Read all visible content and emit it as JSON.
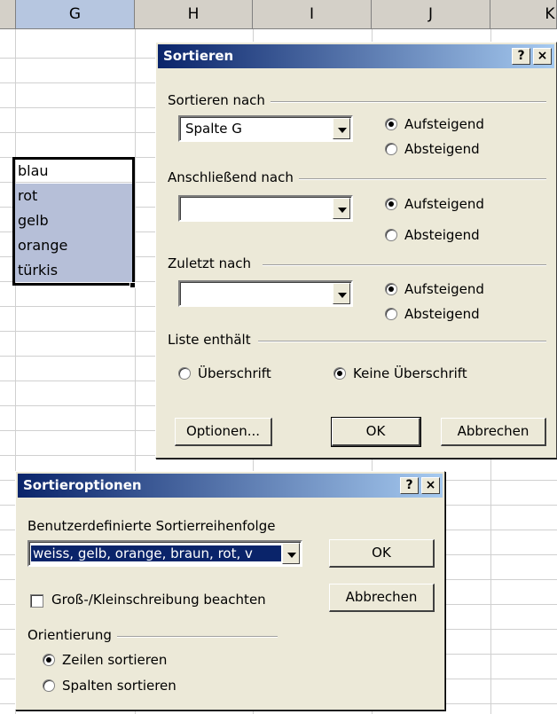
{
  "sheet": {
    "columns": [
      "G",
      "H",
      "I",
      "J",
      "K"
    ],
    "cells": [
      "blau",
      "rot",
      "gelb",
      "orange",
      "türkis"
    ]
  },
  "sort_dialog": {
    "title": "Sortieren",
    "help_label": "?",
    "close_label": "×",
    "sort_by": {
      "label": "Sortieren nach",
      "field_value": "Spalte G",
      "ascending": "Aufsteigend",
      "descending": "Absteigend",
      "selected": "ascending"
    },
    "then_by": {
      "label": "Anschließend nach",
      "field_value": "",
      "ascending": "Aufsteigend",
      "descending": "Absteigend",
      "selected": "ascending"
    },
    "last_by": {
      "label": "Zuletzt nach",
      "field_value": "",
      "ascending": "Aufsteigend",
      "descending": "Absteigend",
      "selected": "ascending"
    },
    "header_group": {
      "label": "Liste enthält",
      "with_header": "Überschrift",
      "no_header": "Keine Überschrift",
      "selected": "no_header"
    },
    "options_button": "Optionen...",
    "ok_button": "OK",
    "cancel_button": "Abbrechen"
  },
  "options_dialog": {
    "title": "Sortieroptionen",
    "help_label": "?",
    "close_label": "×",
    "custom_order_label": "Benutzerdefinierte Sortierreihenfolge",
    "custom_order_value": "weiss, gelb, orange, braun, rot, v",
    "case_sensitive_label": "Groß-/Kleinschreibung beachten",
    "case_sensitive_checked": false,
    "orientation_label": "Orientierung",
    "sort_rows": "Zeilen sortieren",
    "sort_columns": "Spalten sortieren",
    "orientation_selected": "rows",
    "ok_button": "OK",
    "cancel_button": "Abbrechen"
  },
  "colors": {
    "title_bar": "#0a246a",
    "title_bar_end": "#a6caf0",
    "selection": "#b6bfd8",
    "dialog_bg": "#ece9d8"
  }
}
